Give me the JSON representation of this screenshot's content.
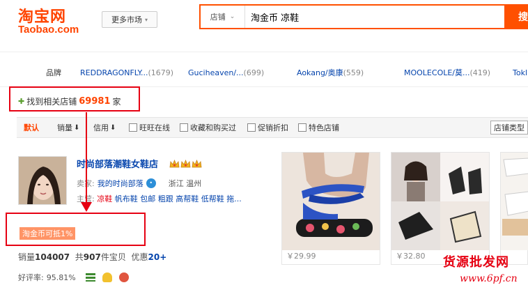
{
  "header": {
    "logo_cn": "淘宝网",
    "logo_en": "Taobao.com",
    "market_label": "更多市场",
    "search_type": "店铺",
    "search_query": "淘金币 凉鞋",
    "search_button": "搜"
  },
  "brands": {
    "label": "品牌",
    "items": [
      {
        "name": "REDDRAGONFLY...",
        "count": "(1679)"
      },
      {
        "name": "Guciheaven/...",
        "count": "(699)"
      },
      {
        "name": "Aokang/奥康",
        "count": "(559)"
      },
      {
        "name": "MOOLECOLE/莫...",
        "count": "(419)"
      },
      {
        "name": "Tokl",
        "count": ""
      }
    ]
  },
  "found": {
    "prefix": "找到相关店铺",
    "count": "69981",
    "suffix": "家"
  },
  "sortbar": {
    "default": "默认",
    "sales": "销量",
    "credit": "信用",
    "filters": [
      "旺旺在线",
      "收藏和购买过",
      "促销折扣",
      "特色店铺"
    ],
    "shop_type": "店铺类型"
  },
  "shop": {
    "name": "时尚部落潮鞋女鞋店",
    "seller_label": "卖家:",
    "seller_name": "我的时尚部落",
    "location": "浙江 温州",
    "main_label": "主营:",
    "main_highlight": "凉鞋",
    "main_items": "帆布鞋 包邮 粗跟 高帮鞋 低帮鞋 拖...",
    "promo": "淘金币可抵1%",
    "sales_label": "销量",
    "sales_value": "104007",
    "items_label": "共",
    "items_value": "907",
    "items_suffix": "件宝贝",
    "coupon_label": "优惠",
    "coupon_value": "20+",
    "rating_label": "好评率:",
    "rating_value": "95.81%"
  },
  "products": [
    {
      "price": "￥29.99"
    },
    {
      "price": "￥32.80"
    },
    {
      "price": ""
    }
  ],
  "watermark": {
    "text": "货源批发网",
    "url": "www.6pf.cn"
  },
  "colors": {
    "accent": "#ff4400",
    "annotation": "#e60012",
    "link": "#0645ad"
  }
}
